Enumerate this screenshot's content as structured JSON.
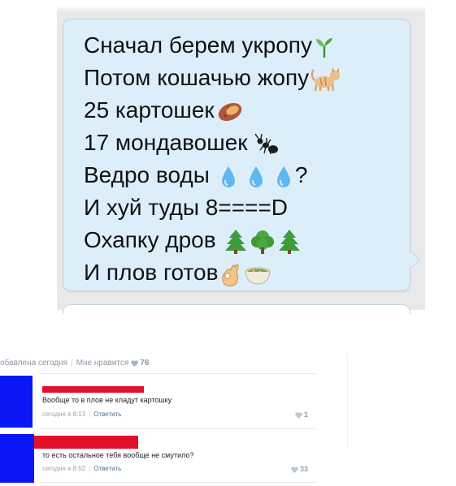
{
  "chat": {
    "lines": [
      {
        "text": "Сначал берем укропу",
        "icons": [
          "sprout-icon"
        ]
      },
      {
        "text": "Потом кошачью жопу",
        "icons": [
          "cat-icon"
        ]
      },
      {
        "text": "25 картошек",
        "icons": [
          "sweet-potato-icon"
        ]
      },
      {
        "text": "17 мондавошек",
        "icons": [
          "ant-icon"
        ]
      },
      {
        "text": "Ведро воды",
        "suffix": "?",
        "icons": [
          "droplet-icon",
          "droplet-icon",
          "droplet-icon"
        ]
      },
      {
        "text": "И хуй туды 8====D",
        "icons": []
      },
      {
        "text": "Охапку дров",
        "icons": [
          "evergreen-tree-icon",
          "deciduous-tree-icon",
          "evergreen-tree-icon"
        ]
      },
      {
        "text": "И плов готов",
        "icons": [
          "ok-hand-icon",
          "soup-bowl-icon"
        ]
      }
    ]
  },
  "post_meta": {
    "added_text": "обавлена сегодня",
    "like_label": "Мне нравится",
    "like_count": "76"
  },
  "comments": [
    {
      "text": "Вообще то в плов не кладут картошку",
      "time": "сегодня в 8:13",
      "reply": "Ответить",
      "likes": "1"
    },
    {
      "text": "то есть остальное тебя вообще не смутило?",
      "time": "сегодня в 8:52",
      "reply": "Ответить",
      "likes": "33"
    }
  ],
  "colors": {
    "bubble": "#ddeefb",
    "avatar_redaction": "#0a17f4",
    "name_redaction": "#e3102a",
    "link": "#4f6d8f"
  }
}
